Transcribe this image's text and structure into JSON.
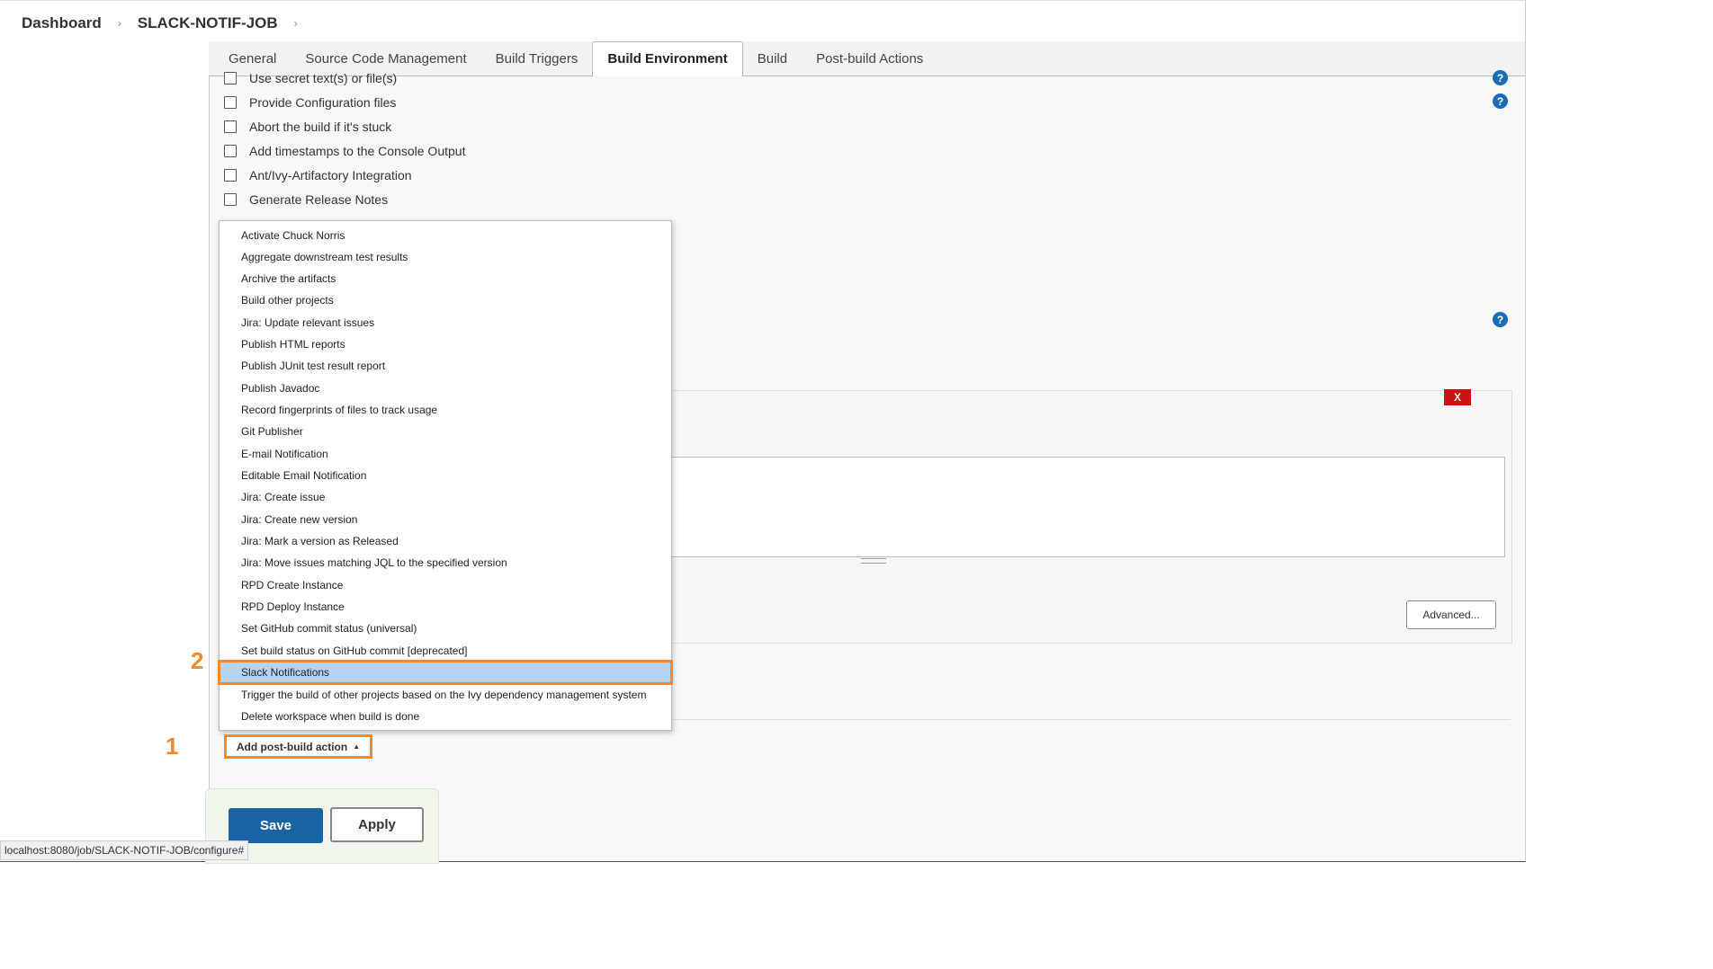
{
  "breadcrumb": {
    "dashboard": "Dashboard",
    "job": "SLACK-NOTIF-JOB",
    "sep": "›"
  },
  "tabs": [
    "General",
    "Source Code Management",
    "Build Triggers",
    "Build Environment",
    "Build",
    "Post-build Actions"
  ],
  "active_tab": "Build Environment",
  "build_env_options": [
    "Use secret text(s) or file(s)",
    "Provide Configuration files",
    "Abort the build if it's stuck",
    "Add timestamps to the Console Output",
    "Ant/Ivy-Artifactory Integration",
    "Generate Release Notes"
  ],
  "dropdown_items": [
    "Activate Chuck Norris",
    "Aggregate downstream test results",
    "Archive the artifacts",
    "Build other projects",
    "Jira: Update relevant issues",
    "Publish HTML reports",
    "Publish JUnit test result report",
    "Publish Javadoc",
    "Record fingerprints of files to track usage",
    "Git Publisher",
    "E-mail Notification",
    "Editable Email Notification",
    "Jira: Create issue",
    "Jira: Create new version",
    "Jira: Mark a version as Released",
    "Jira: Move issues matching JQL to the specified version",
    "RPD Create Instance",
    "RPD Deploy Instance",
    "Set GitHub commit status (universal)",
    "Set build status on GitHub commit [deprecated]",
    "Slack Notifications",
    "Trigger the build of other projects based on the Ivy dependency management system",
    "Delete workspace when build is done"
  ],
  "highlighted_item": "Slack Notifications",
  "annotations": {
    "step1": "1",
    "step2": "2"
  },
  "buttons": {
    "add_post_build": "Add post-build action",
    "advanced": "Advanced...",
    "save": "Save",
    "apply": "Apply",
    "delete": "X",
    "help": "?"
  },
  "status_bar": "localhost:8080/job/SLACK-NOTIF-JOB/configure#",
  "colors": {
    "accent": "#f08a2c",
    "primary": "#1a64a6",
    "highlight": "#b5d3f3",
    "danger": "#cc1111"
  }
}
